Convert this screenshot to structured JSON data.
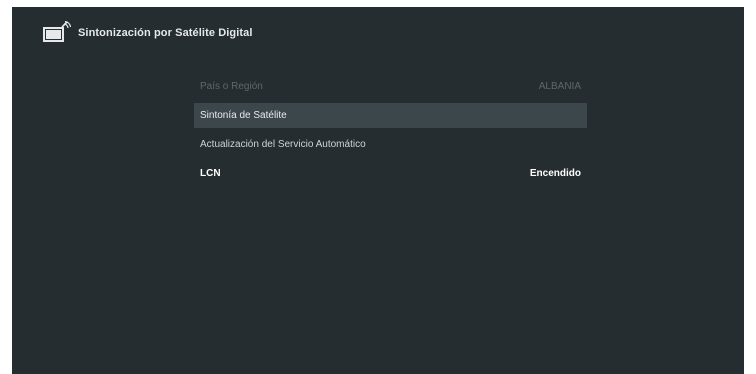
{
  "header": {
    "title": "Sintonización por Satélite Digital",
    "icon": "satellite-tv-icon"
  },
  "menu": {
    "items": [
      {
        "label": "País o Región",
        "value": "ALBANIA",
        "state": "disabled"
      },
      {
        "label": "Sintonía de Satélite",
        "value": "",
        "state": "selected"
      },
      {
        "label": "Actualización del Servicio Automático",
        "value": "",
        "state": "normal"
      },
      {
        "label": "LCN",
        "value": "Encendido",
        "state": "normal"
      }
    ]
  },
  "colors": {
    "background": "#252d31",
    "selected_row": "#3c474c",
    "text": "#cfd3d5",
    "disabled_text": "#5e676b"
  }
}
